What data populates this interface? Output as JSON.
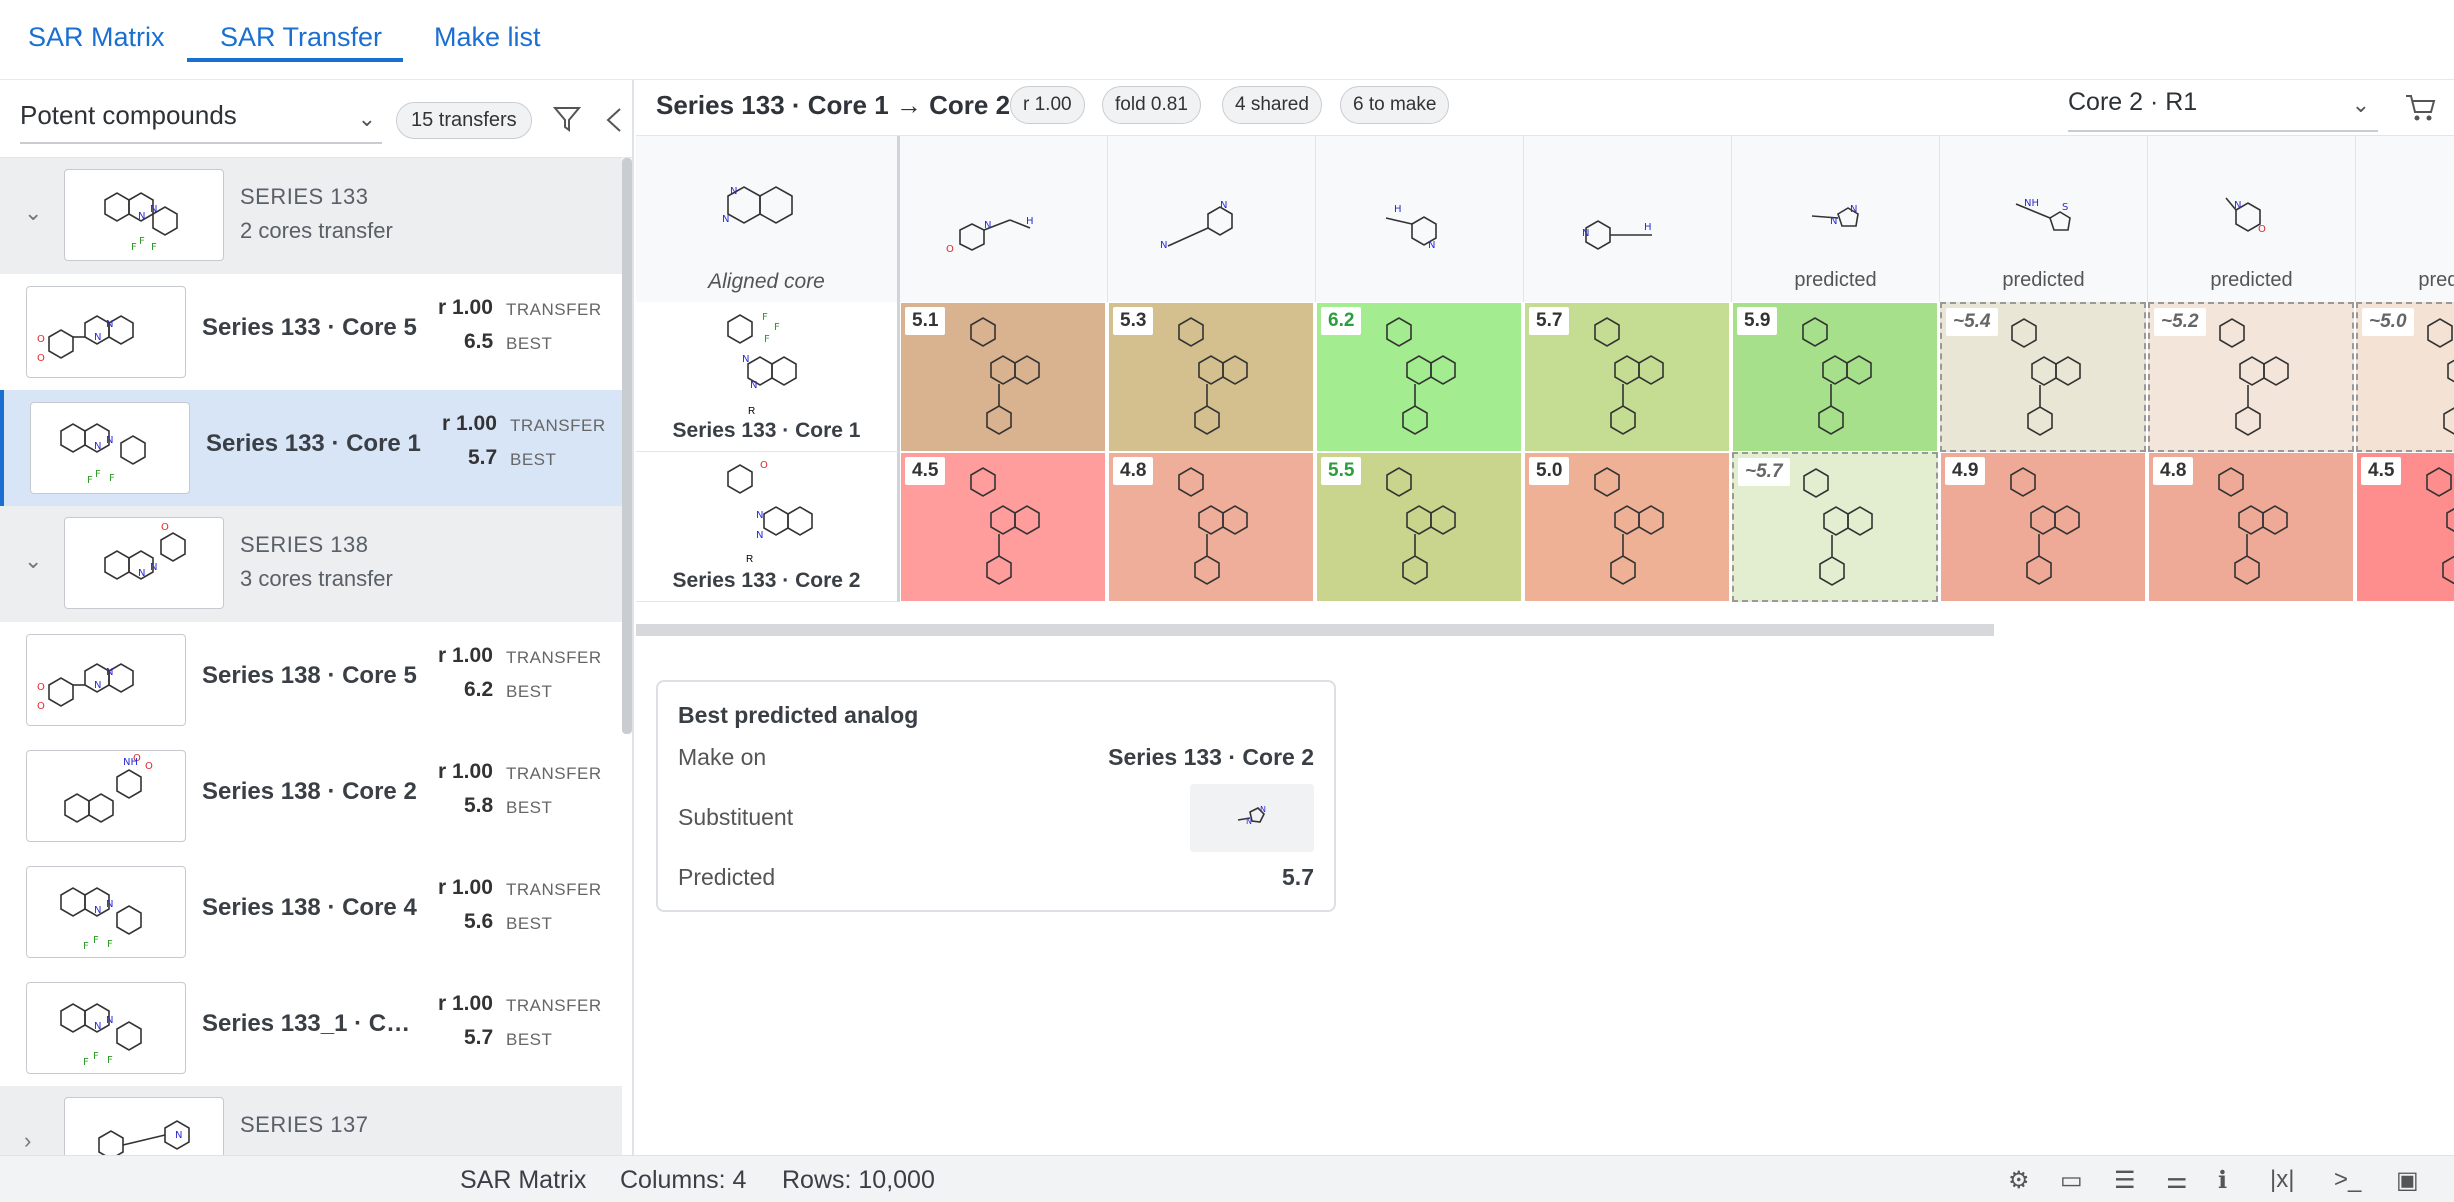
{
  "tabs": [
    {
      "label": "SAR Matrix"
    },
    {
      "label": "SAR Transfer"
    },
    {
      "label": "Make list"
    }
  ],
  "left_panel": {
    "dropdown_value": "Potent compounds",
    "transfers_pill": "15 transfers",
    "groups": [
      {
        "title": "SERIES 133",
        "subtitle": "2 cores transfer"
      },
      {
        "title": "SERIES 138",
        "subtitle": "3 cores transfer"
      },
      {
        "title": "SERIES 137",
        "subtitle": ""
      }
    ],
    "items": [
      {
        "name": "Series 133 · Core 5",
        "r": "r 1.00",
        "r_label": "TRANSFER",
        "best": "6.5",
        "best_label": "BEST"
      },
      {
        "name": "Series 133 · Core 1",
        "r": "r 1.00",
        "r_label": "TRANSFER",
        "best": "5.7",
        "best_label": "BEST"
      },
      {
        "name": "Series 138 · Core 5",
        "r": "r 1.00",
        "r_label": "TRANSFER",
        "best": "6.2",
        "best_label": "BEST"
      },
      {
        "name": "Series 138 · Core 2",
        "r": "r 1.00",
        "r_label": "TRANSFER",
        "best": "5.8",
        "best_label": "BEST"
      },
      {
        "name": "Series 138 · Core 4",
        "r": "r 1.00",
        "r_label": "TRANSFER",
        "best": "5.6",
        "best_label": "BEST"
      },
      {
        "name": "Series 133_1 · Cor...",
        "r": "r 1.00",
        "r_label": "TRANSFER",
        "best": "5.7",
        "best_label": "BEST"
      }
    ]
  },
  "header": {
    "title": "Series 133 · Core 1 → Core 2",
    "badges": [
      "r 1.00",
      "fold 0.81",
      "4 shared",
      "6 to make"
    ],
    "core_select": "Core 2 · R1"
  },
  "matrix": {
    "r_label": "R",
    "aligned_core_label": "Aligned core",
    "predicted_label": "predicted",
    "rows": [
      {
        "label": "Series 133 · Core 1",
        "cells": [
          "5.1",
          "5.3",
          "6.2",
          "5.7",
          "5.9",
          "~5.4",
          "~5.2",
          "~5.0"
        ]
      },
      {
        "label": "Series 133 · Core 2",
        "cells": [
          "4.5",
          "4.8",
          "5.5",
          "5.0",
          "~5.7",
          "4.9",
          "4.8",
          "4.5"
        ]
      }
    ],
    "row_colors": [
      [
        "#d9b38f",
        "#d3c08e",
        "#a3ec8f",
        "#c4dd93",
        "#a6e08a",
        "#e9e6d5",
        "#f4e5db",
        "#f4e2d5"
      ],
      [
        "#ff9c9c",
        "#eeae99",
        "#c9d48d",
        "#eeb196",
        "#e2eecf",
        "#eeaa96",
        "#eeaa96",
        "#fe8e8e"
      ]
    ],
    "predicted_flags": [
      [
        false,
        false,
        false,
        false,
        false,
        true,
        true,
        true
      ],
      [
        false,
        false,
        false,
        false,
        true,
        false,
        false,
        false
      ]
    ]
  },
  "analog_card": {
    "title": "Best predicted analog",
    "make_on_label": "Make on",
    "make_on_value": "Series 133 · Core 2",
    "substituent_label": "Substituent",
    "predicted_label": "Predicted",
    "predicted_value": "5.7"
  },
  "status_bar": {
    "view": "SAR Matrix",
    "columns": "Columns: 4",
    "rows": "Rows: 10,000"
  }
}
